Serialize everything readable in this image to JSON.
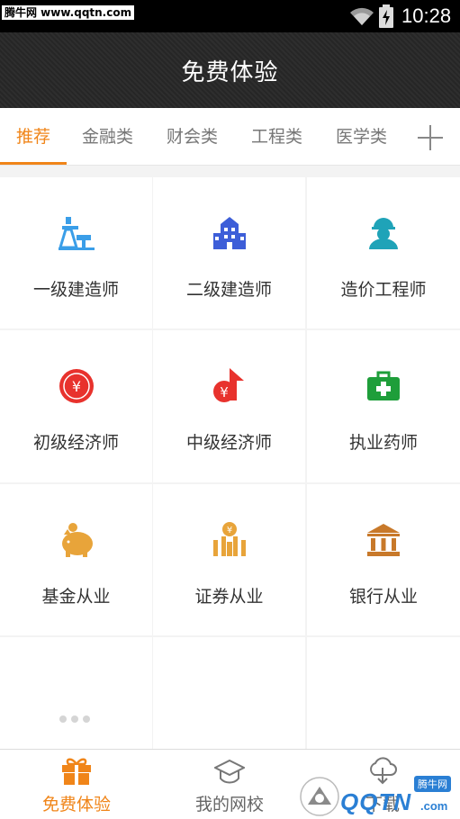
{
  "status_bar": {
    "watermark": "腾牛网 www.qqtn.com",
    "time": "10:28"
  },
  "header": {
    "title": "免费体验"
  },
  "tabs": [
    {
      "label": "推荐",
      "active": true
    },
    {
      "label": "金融类",
      "active": false
    },
    {
      "label": "财会类",
      "active": false
    },
    {
      "label": "工程类",
      "active": false
    },
    {
      "label": "医学类",
      "active": false
    }
  ],
  "grid": [
    {
      "label": "一级建造师",
      "icon": "oil-derrick-icon"
    },
    {
      "label": "二级建造师",
      "icon": "building-icon"
    },
    {
      "label": "造价工程师",
      "icon": "engineer-worker-icon"
    },
    {
      "label": "初级经济师",
      "icon": "yuan-coin-icon"
    },
    {
      "label": "中级经济师",
      "icon": "yuan-growth-arrow-icon"
    },
    {
      "label": "执业药师",
      "icon": "medical-kit-icon"
    },
    {
      "label": "基金从业",
      "icon": "piggy-bank-icon"
    },
    {
      "label": "证券从业",
      "icon": "bar-chart-coin-icon"
    },
    {
      "label": "银行从业",
      "icon": "bank-icon"
    }
  ],
  "bottom_nav": [
    {
      "label": "免费体验",
      "icon": "gift-icon",
      "active": true
    },
    {
      "label": "我的网校",
      "icon": "graduation-cap-icon",
      "active": false
    },
    {
      "label": "下载",
      "icon": "cloud-download-icon",
      "active": false
    }
  ],
  "watermark_logo": {
    "text": "QQTN",
    "suffix": ".com",
    "tag": "腾牛网"
  },
  "colors": {
    "accent": "#f08519",
    "header_bg": "#2a2a2a",
    "blue": "#3a9ee8",
    "red": "#e8322d",
    "green": "#1e9e3a",
    "gold": "#e8a43a"
  }
}
